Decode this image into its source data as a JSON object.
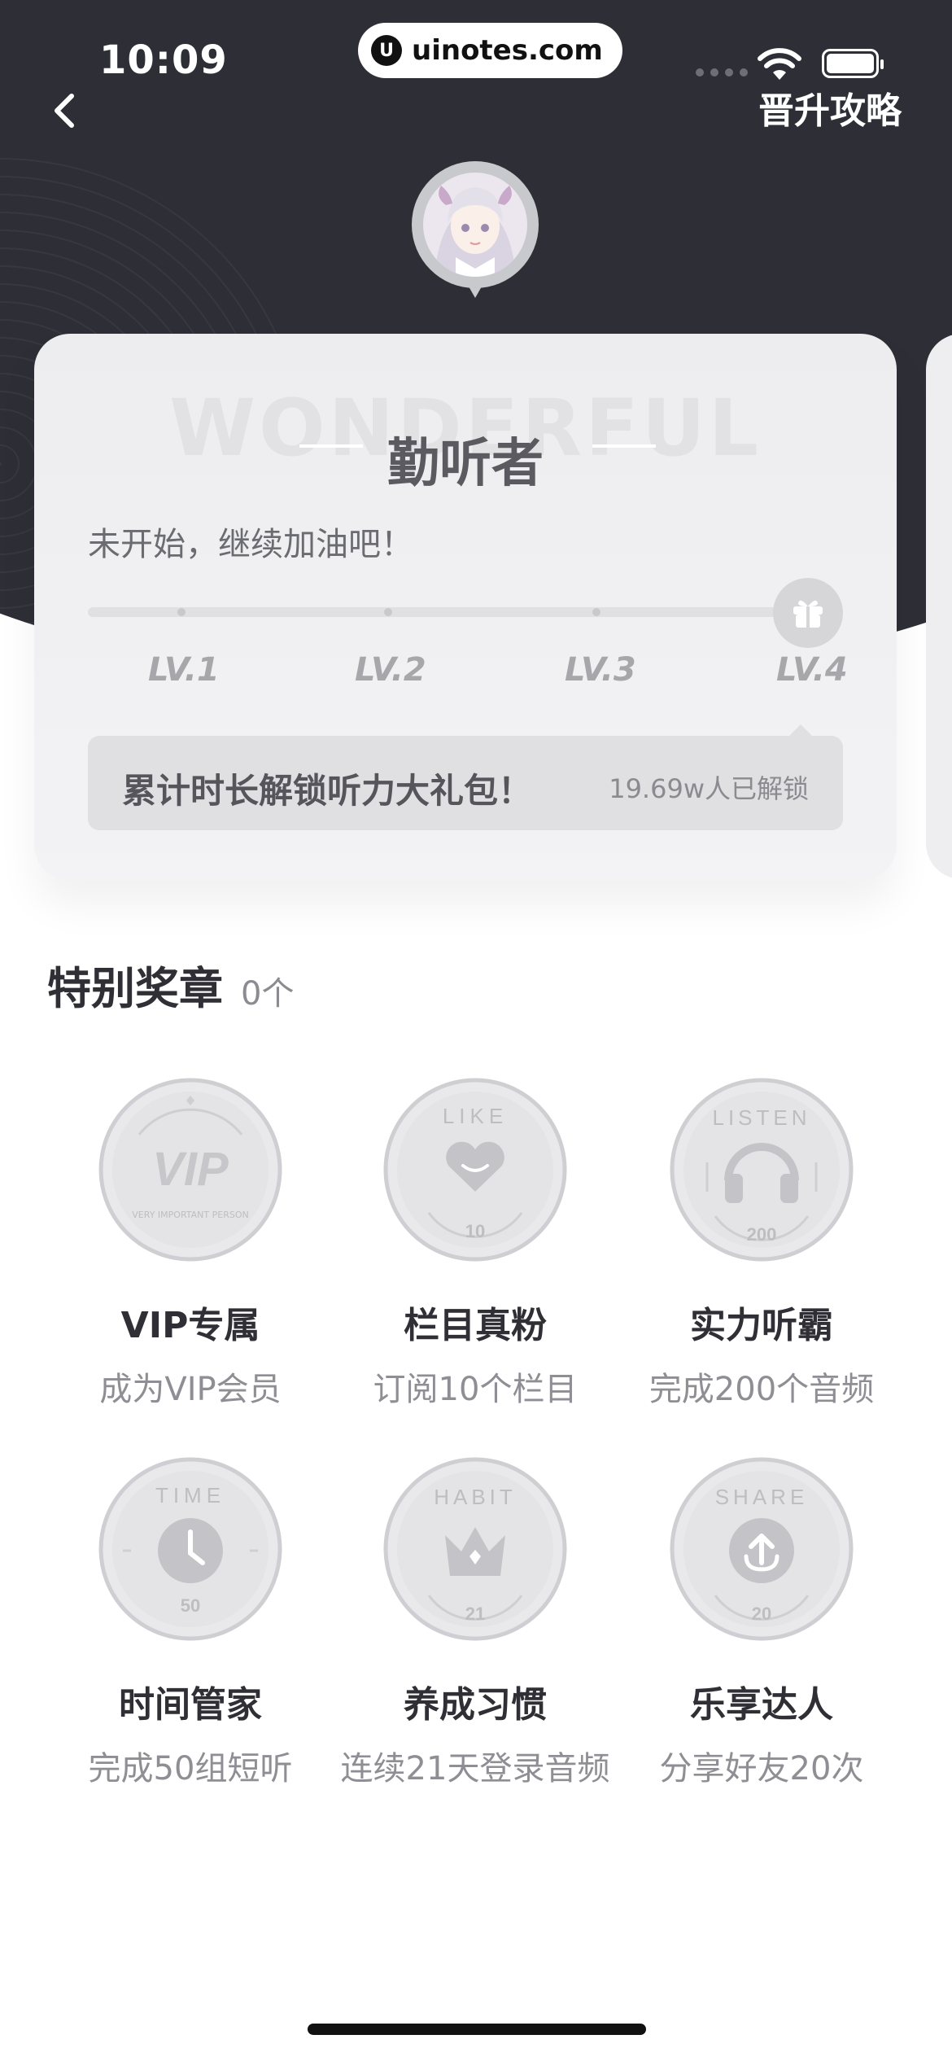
{
  "status_bar": {
    "time": "10:09",
    "url": "uinotes.com",
    "url_logo": "U"
  },
  "header": {
    "back_icon": "chevron-left-icon",
    "upgrade_link": "晋升攻略"
  },
  "level_card": {
    "watermark": "WONDERFUL",
    "level_name": "勤听者",
    "status": "未开始，继续加油吧！",
    "progress": 0,
    "levels": [
      "LV.1",
      "LV.2",
      "LV.3",
      "LV.4"
    ],
    "gift_icon": "gift-icon",
    "unlock_banner": {
      "title": "累计时长解锁听力大礼包！",
      "count": "19.69w人已解锁"
    }
  },
  "special_badges": {
    "title": "特别奖章",
    "count": "0个",
    "items": [
      {
        "medal_top": "VIP",
        "medal_bottom": "VERY IMPORTANT PERSON",
        "icon": "vip-icon",
        "name": "VIP专属",
        "desc": "成为VIP会员"
      },
      {
        "medal_top": "LIKE",
        "medal_bottom": "10",
        "icon": "heart-icon",
        "name": "栏目真粉",
        "desc": "订阅10个栏目"
      },
      {
        "medal_top": "LISTEN",
        "medal_bottom": "200",
        "icon": "headphones-icon",
        "name": "实力听霸",
        "desc": "完成200个音频"
      },
      {
        "medal_top": "TIME",
        "medal_bottom": "50",
        "icon": "clock-icon",
        "name": "时间管家",
        "desc": "完成50组短听"
      },
      {
        "medal_top": "HABIT",
        "medal_bottom": "21",
        "icon": "crown-icon",
        "name": "养成习惯",
        "desc": "连续21天登录音频"
      },
      {
        "medal_top": "SHARE",
        "medal_bottom": "20",
        "icon": "share-upload-icon",
        "name": "乐享达人",
        "desc": "分享好友20次"
      }
    ]
  }
}
